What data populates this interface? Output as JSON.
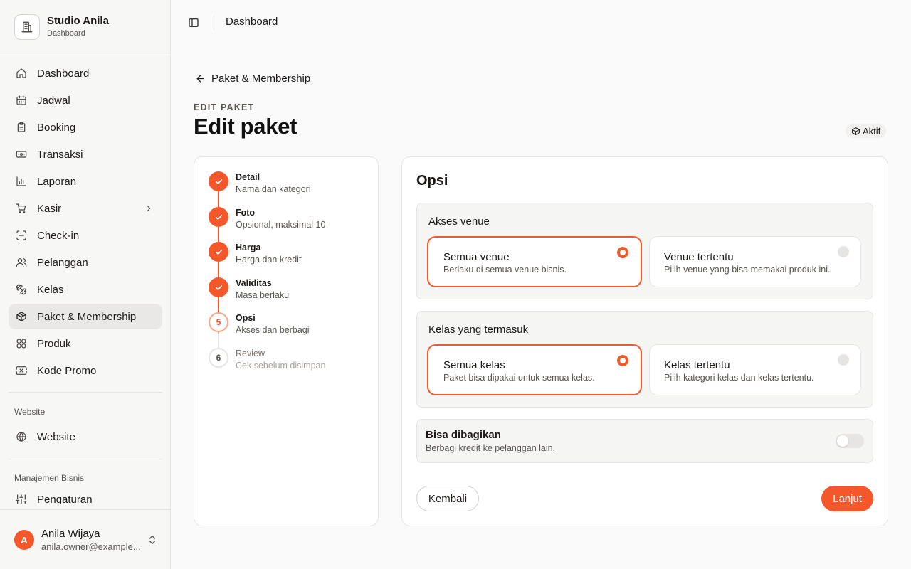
{
  "brand": {
    "name": "Studio Anila",
    "subtitle": "Dashboard"
  },
  "sidebar": {
    "items": [
      {
        "label": "Dashboard",
        "icon": "home-icon"
      },
      {
        "label": "Jadwal",
        "icon": "calendar-icon"
      },
      {
        "label": "Booking",
        "icon": "clipboard-icon"
      },
      {
        "label": "Transaksi",
        "icon": "banknote-icon"
      },
      {
        "label": "Laporan",
        "icon": "bar-chart-icon"
      },
      {
        "label": "Kasir",
        "icon": "cart-icon",
        "has_submenu": true
      },
      {
        "label": "Check-in",
        "icon": "scan-icon"
      },
      {
        "label": "Pelanggan",
        "icon": "users-icon"
      },
      {
        "label": "Kelas",
        "icon": "dumbbell-icon"
      },
      {
        "label": "Paket & Membership",
        "icon": "package-icon",
        "active": true
      },
      {
        "label": "Produk",
        "icon": "shapes-icon"
      },
      {
        "label": "Kode Promo",
        "icon": "ticket-icon"
      }
    ],
    "website_section": {
      "label": "Website",
      "items": [
        {
          "label": "Website",
          "icon": "globe-icon"
        }
      ]
    },
    "business_section": {
      "label": "Manajemen Bisnis",
      "items": [
        {
          "label": "Pengaturan",
          "icon": "settings-icon"
        }
      ]
    }
  },
  "user": {
    "initial": "A",
    "name": "Anila Wijaya",
    "email": "anila.owner@example..."
  },
  "topbar": {
    "title": "Dashboard"
  },
  "main": {
    "back_label": "Paket & Membership",
    "overline": "EDIT PAKET",
    "title": "Edit paket",
    "status_badge": "Aktif"
  },
  "steps": [
    {
      "title": "Detail",
      "desc": "Nama dan kategori",
      "state": "done"
    },
    {
      "title": "Foto",
      "desc": "Opsional, maksimal 10",
      "state": "done"
    },
    {
      "title": "Harga",
      "desc": "Harga dan kredit",
      "state": "done"
    },
    {
      "title": "Validitas",
      "desc": "Masa berlaku",
      "state": "done"
    },
    {
      "title": "Opsi",
      "desc": "Akses dan berbagi",
      "state": "current",
      "number": "5"
    },
    {
      "title": "Review",
      "desc": "Cek sebelum disimpan",
      "state": "todo",
      "number": "6"
    }
  ],
  "options": {
    "title": "Opsi",
    "venue": {
      "label": "Akses venue",
      "all": {
        "title": "Semua venue",
        "desc": "Berlaku di semua venue bisnis.",
        "selected": true
      },
      "specific": {
        "title": "Venue tertentu",
        "desc": "Pilih venue yang bisa memakai produk ini.",
        "selected": false
      }
    },
    "classes": {
      "label": "Kelas yang termasuk",
      "all": {
        "title": "Semua kelas",
        "desc": "Paket bisa dipakai untuk semua kelas.",
        "selected": true
      },
      "specific": {
        "title": "Kelas tertentu",
        "desc": "Pilih kategori kelas dan kelas tertentu.",
        "selected": false
      }
    },
    "share": {
      "title": "Bisa dibagikan",
      "desc": "Berbagi kredit ke pelanggan lain.",
      "enabled": false
    },
    "back_button": "Kembali",
    "next_button": "Lanjut"
  },
  "colors": {
    "accent": "#f4572a",
    "sidebar_bg": "#f7f7f6",
    "page_bg": "#fafafa"
  }
}
